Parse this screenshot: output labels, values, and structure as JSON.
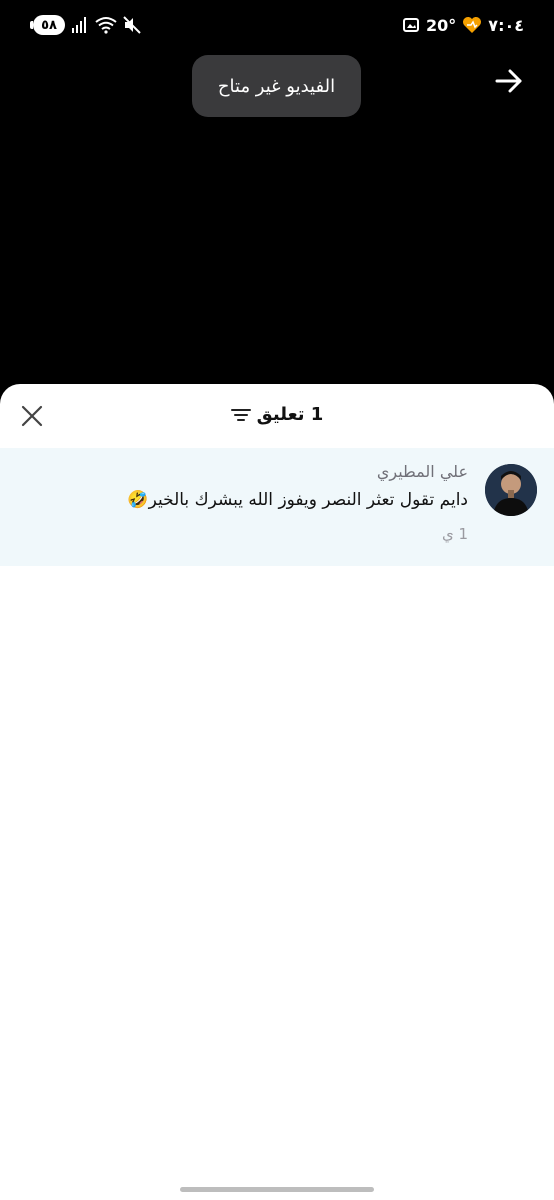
{
  "status_bar": {
    "battery": "٥٨",
    "time": "٧:٠٤",
    "temperature": "20°",
    "icons": [
      "battery-icon",
      "signal-icon",
      "wifi-icon",
      "mute-icon",
      "gallery-icon",
      "heart-app-icon"
    ]
  },
  "video": {
    "toast": "الفيديو غير متاح",
    "forward_icon": "arrow-right-icon"
  },
  "comments": {
    "count": "1",
    "title": "تعليق",
    "items": [
      {
        "author": "علي المطيري",
        "text": "دايم تقول تعثر النصر ويفوز الله يبشرك بالخير🤣",
        "time": "1 ي"
      }
    ]
  },
  "colors": {
    "comment_bg": "#f0f8fb",
    "toast_bg": "#3a3a3c",
    "accent_heart": "#f5a000"
  }
}
